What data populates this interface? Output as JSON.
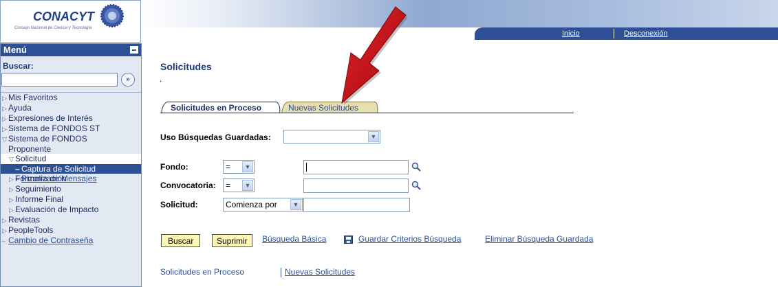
{
  "header": {
    "logo_text": "CONACYT",
    "logo_subtitle": "Consejo Nacional de Ciencia y Tecnología",
    "nav": {
      "home": "Inicio",
      "logout": "Desconexión"
    }
  },
  "sidebar": {
    "title": "Menú",
    "search_label": "Buscar:",
    "search_value": "",
    "search_go": "»",
    "items": [
      {
        "label": "Mis Favoritos",
        "marker": "▷"
      },
      {
        "label": "Ayuda",
        "marker": "▷"
      },
      {
        "label": "Expresiones de Interés",
        "marker": "▷"
      },
      {
        "label": "Sistema de FONDOS ST",
        "marker": "▷"
      },
      {
        "label": "Sistema de FONDOS",
        "marker": "▽"
      },
      {
        "label": "Proponente",
        "marker": ""
      },
      {
        "label": "Solicitud",
        "marker": "▽"
      },
      {
        "label": "Captura de Solicitud",
        "marker": "–"
      },
      {
        "label": "Pizarra de Mensajes",
        "marker": "–"
      },
      {
        "label": "Formalización",
        "marker": "▷"
      },
      {
        "label": "Seguimiento",
        "marker": "▷"
      },
      {
        "label": "Informe Final",
        "marker": "▷"
      },
      {
        "label": "Evaluación de Impacto",
        "marker": "▷"
      },
      {
        "label": "Revistas",
        "marker": "▷"
      },
      {
        "label": "PeopleTools",
        "marker": "▷"
      },
      {
        "label": "Cambio de Contraseña",
        "marker": "–"
      }
    ]
  },
  "main": {
    "title": "Solicitudes",
    "dot": ".",
    "tabs": [
      {
        "label": "Solicitudes en Proceso",
        "active": true
      },
      {
        "label": "Nuevas Solicitudes",
        "active": false
      }
    ],
    "saved_search_label": "Uso Búsquedas Guardadas:",
    "saved_search_value": "",
    "fields": {
      "fondo_label": "Fondo:",
      "fondo_operator": "=",
      "fondo_value": "",
      "convocatoria_label": "Convocatoria:",
      "convocatoria_operator": "=",
      "convocatoria_value": "",
      "solicitud_label": "Solicitud:",
      "solicitud_operator": "Comienza por",
      "solicitud_value": ""
    },
    "buttons": {
      "search": "Buscar",
      "clear": "Suprimir"
    },
    "links": {
      "basic_search": "Búsqueda Básica",
      "save_criteria": "Guardar Criterios Búsqueda",
      "delete_saved": "Eliminar Búsqueda Guardada"
    },
    "bottom_links": {
      "in_process": "Solicitudes en Proceso",
      "new": "Nuevas Solicitudes"
    }
  },
  "colors": {
    "brand_blue": "#2d4f96",
    "active_tab": "#ffffff",
    "inactive_tab": "#e8dfb0",
    "button_bg": "#fdf7b5",
    "annotation_arrow": "#c8141c"
  },
  "icons": {
    "search_go": "double-chevron-right-icon",
    "lookup": "magnifier-icon",
    "save": "floppy-disk-icon",
    "annotation": "red-arrow-icon"
  }
}
